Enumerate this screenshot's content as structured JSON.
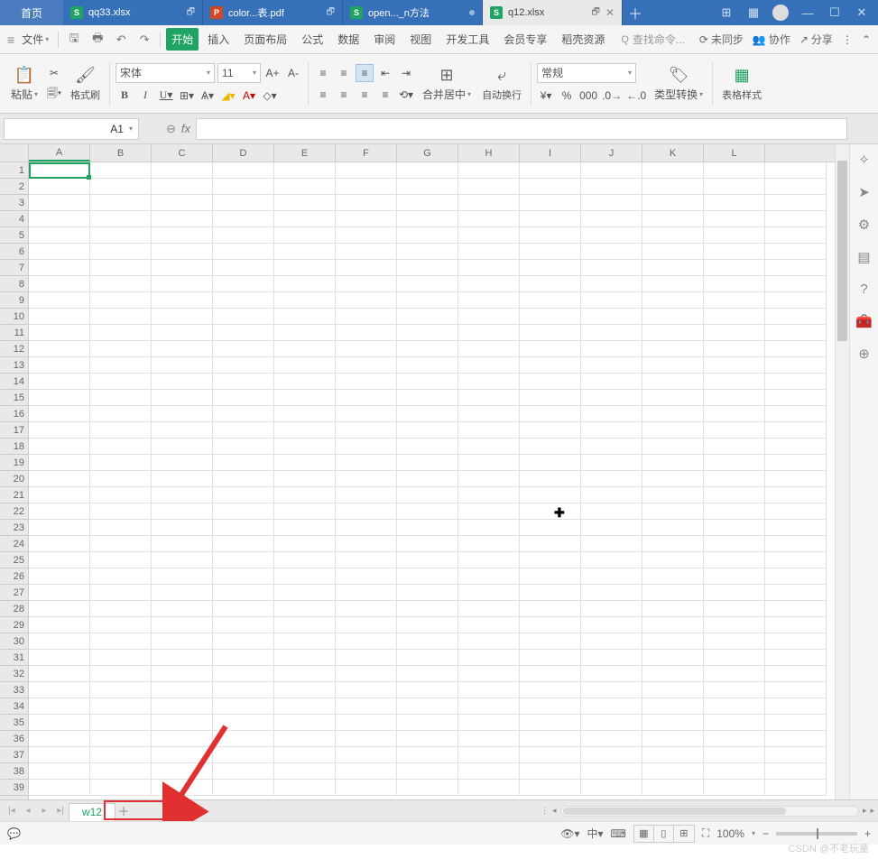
{
  "titlebar": {
    "home": "首页",
    "tabs": [
      {
        "icon": "S",
        "iconClass": "ic-s",
        "label": "qq33.xlsx",
        "dot": false
      },
      {
        "icon": "P",
        "iconClass": "ic-p",
        "label": "color...表.pdf",
        "dot": false
      },
      {
        "icon": "S",
        "iconClass": "ic-s",
        "label": "open..._n方法",
        "dot": true
      },
      {
        "icon": "S",
        "iconClass": "ic-s",
        "label": "q12.xlsx",
        "dot": false,
        "active": true
      }
    ]
  },
  "menubar": {
    "file": "文件",
    "tabs": [
      "开始",
      "插入",
      "页面布局",
      "公式",
      "数据",
      "审阅",
      "视图",
      "开发工具",
      "会员专享",
      "稻壳资源"
    ],
    "search_ph": "查找命令...",
    "right": {
      "sync": "未同步",
      "coop": "协作",
      "share": "分享"
    }
  },
  "ribbon": {
    "paste": "粘贴",
    "format_painter": "格式刷",
    "font_name": "宋体",
    "font_size": "11",
    "merge": "合并居中",
    "wrap": "自动换行",
    "number_format": "常规",
    "type_convert": "类型转换",
    "table_style": "表格样式"
  },
  "namebox": "A1",
  "columns": [
    "A",
    "B",
    "C",
    "D",
    "E",
    "F",
    "G",
    "H",
    "I",
    "J",
    "K",
    "L"
  ],
  "rows": 39,
  "sheet_tabs": {
    "active": "w12"
  },
  "statusbar": {
    "zoom": "100%"
  },
  "watermark": "CSDN @不老玩童"
}
